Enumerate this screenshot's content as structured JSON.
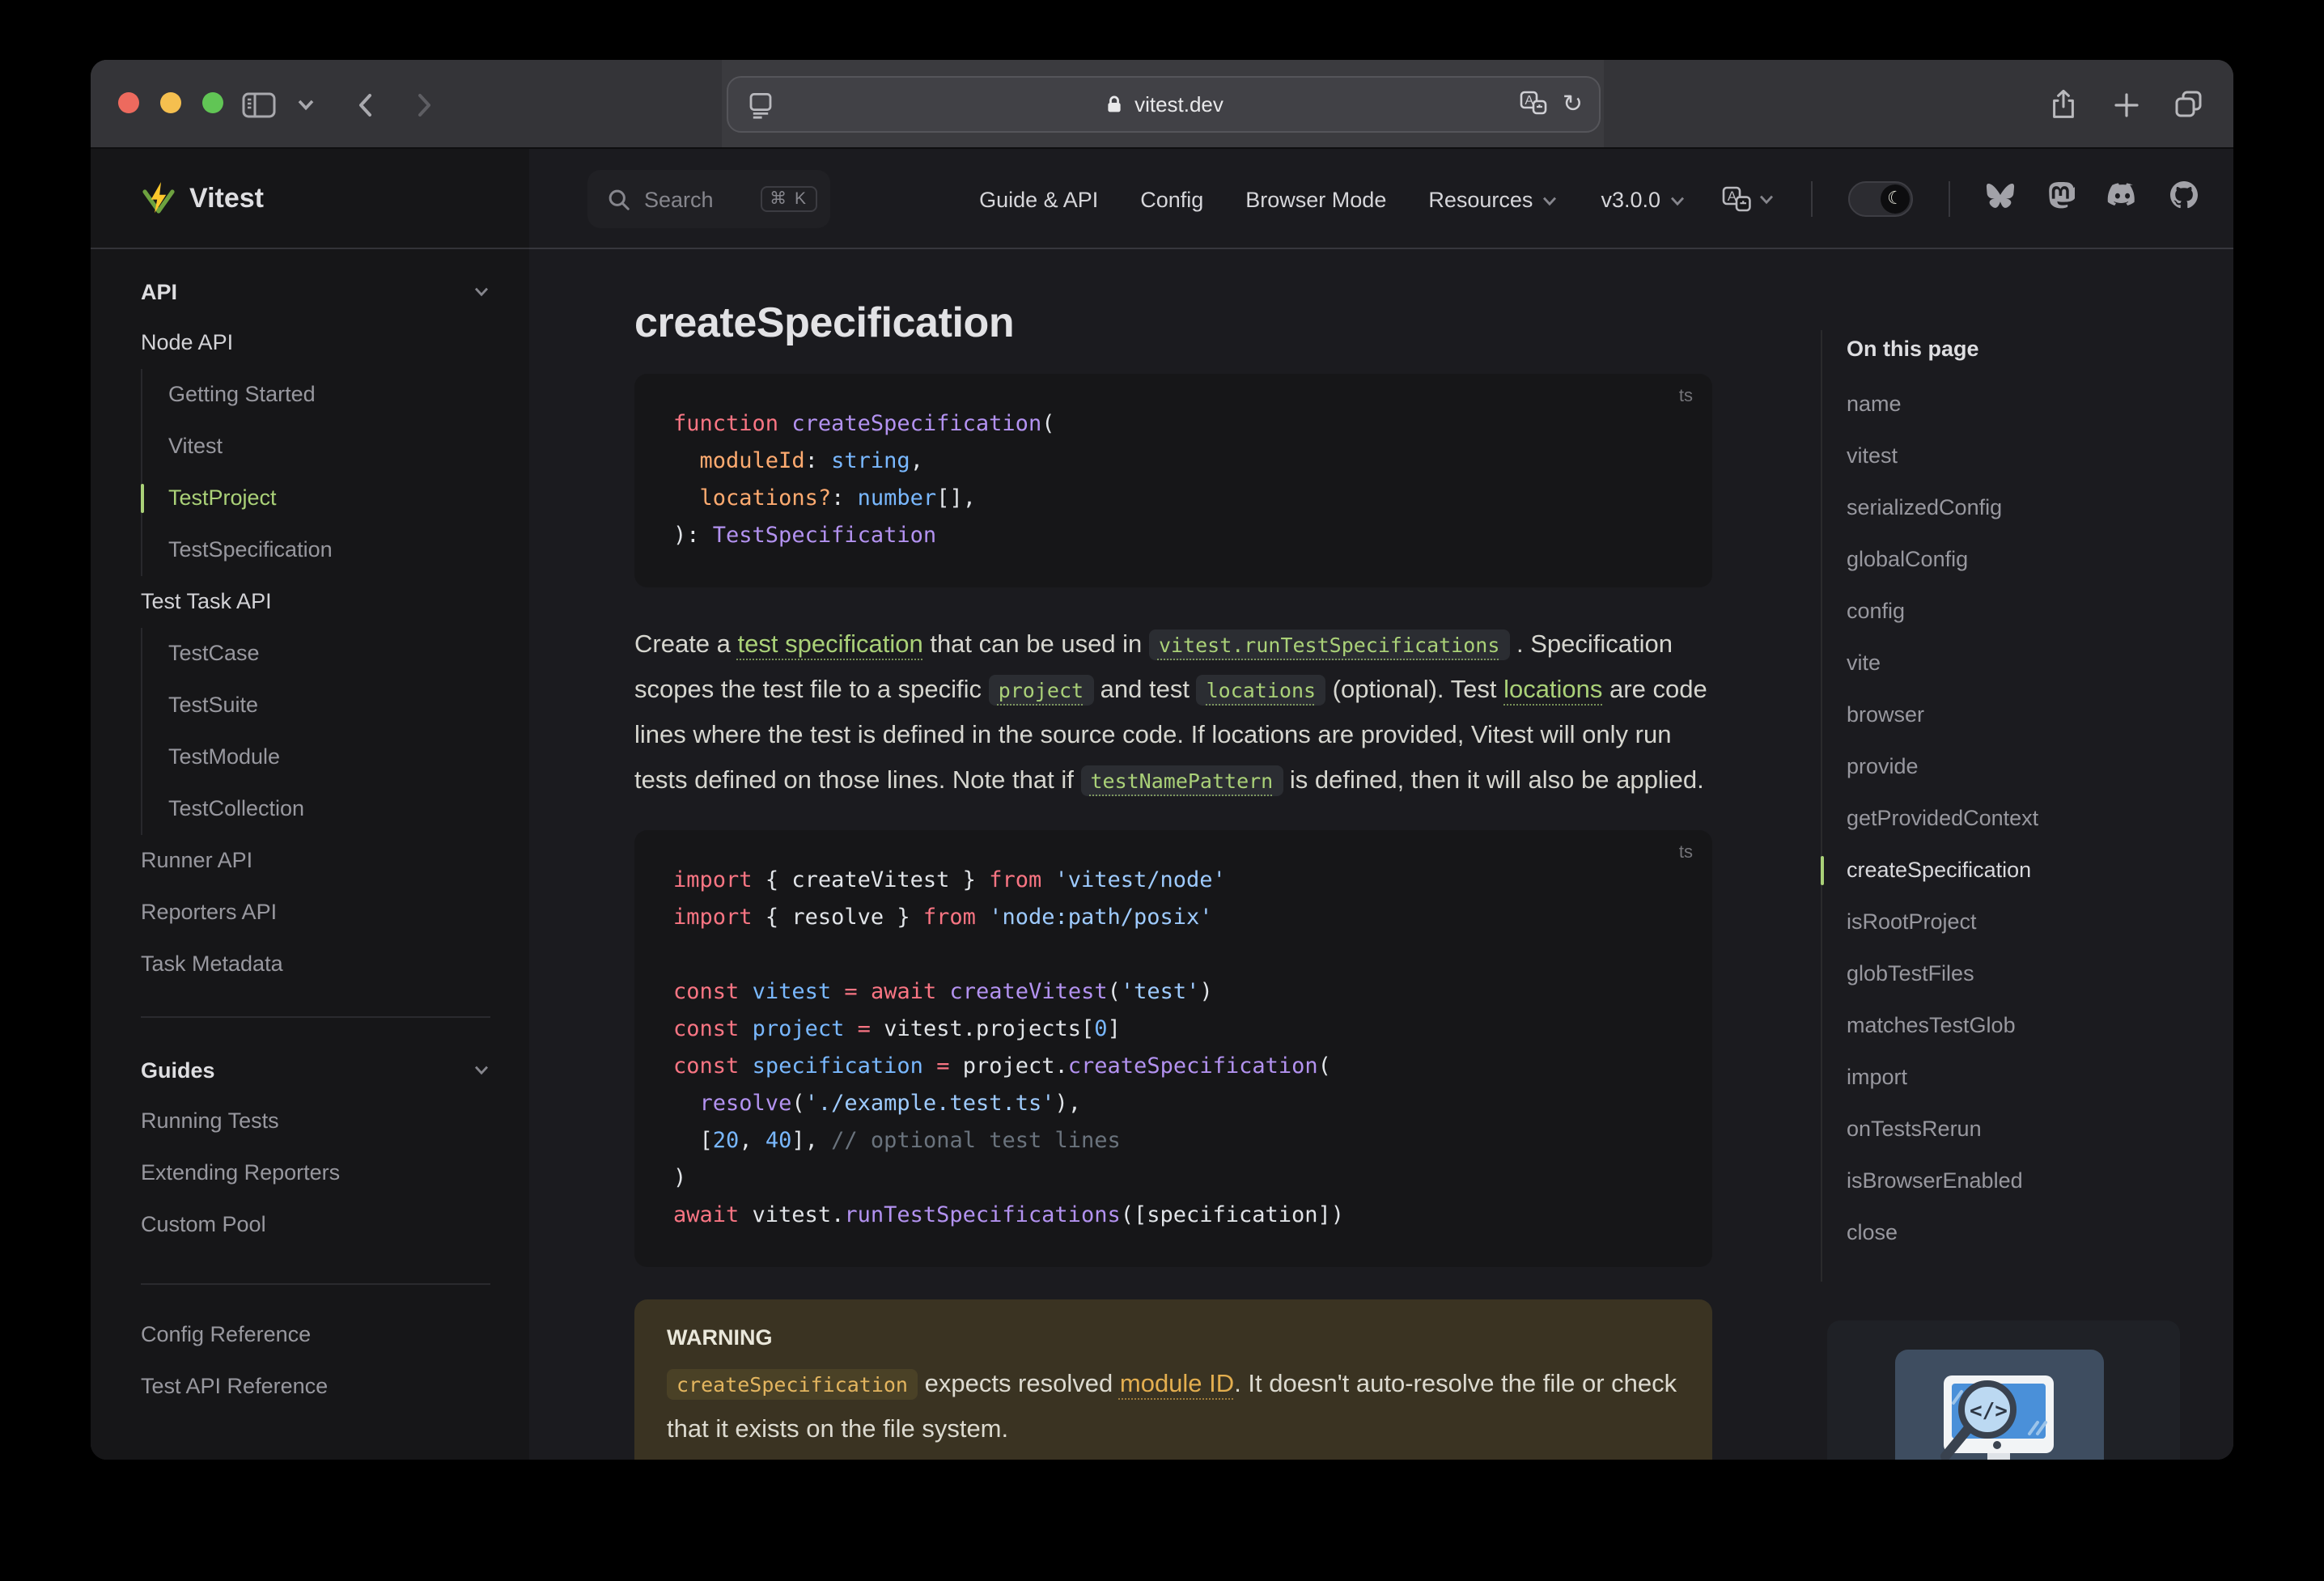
{
  "browser": {
    "url": "vitest.dev",
    "traffic_lights": [
      "close",
      "minimize",
      "zoom"
    ]
  },
  "nav": {
    "search_label": "Search",
    "search_kbd": "⌘ K",
    "items": [
      {
        "label": "Guide & API",
        "chevron": false
      },
      {
        "label": "Config",
        "chevron": false
      },
      {
        "label": "Browser Mode",
        "chevron": false
      },
      {
        "label": "Resources",
        "chevron": true
      },
      {
        "label": "v3.0.0",
        "chevron": true
      }
    ],
    "socials": [
      "bluesky",
      "mastodon",
      "discord",
      "github"
    ]
  },
  "sidebar": {
    "logo_text": "Vitest",
    "entries": [
      {
        "kind": "section",
        "label": "API"
      },
      {
        "kind": "group",
        "label": "Node API",
        "children": [
          {
            "label": "Getting Started",
            "active": false
          },
          {
            "label": "Vitest",
            "active": false
          },
          {
            "label": "TestProject",
            "active": true
          },
          {
            "label": "TestSpecification",
            "active": false
          }
        ]
      },
      {
        "kind": "group",
        "label": "Test Task API",
        "children": [
          {
            "label": "TestCase",
            "active": false
          },
          {
            "label": "TestSuite",
            "active": false
          },
          {
            "label": "TestModule",
            "active": false
          },
          {
            "label": "TestCollection",
            "active": false
          }
        ]
      },
      {
        "kind": "link",
        "label": "Runner API"
      },
      {
        "kind": "link",
        "label": "Reporters API"
      },
      {
        "kind": "link",
        "label": "Task Metadata"
      },
      {
        "kind": "divider"
      },
      {
        "kind": "section",
        "label": "Guides"
      },
      {
        "kind": "link",
        "label": "Running Tests"
      },
      {
        "kind": "link",
        "label": "Extending Reporters"
      },
      {
        "kind": "link",
        "label": "Custom Pool"
      },
      {
        "kind": "divider-lower"
      },
      {
        "kind": "link",
        "label": "Config Reference"
      },
      {
        "kind": "link",
        "label": "Test API Reference"
      }
    ]
  },
  "content": {
    "heading": "createSpecification",
    "code_blocks": [
      {
        "lang": "ts",
        "lines": [
          [
            [
              "k",
              "function"
            ],
            [
              "pl",
              " "
            ],
            [
              "fn",
              "createSpecification"
            ],
            [
              "pl",
              "("
            ]
          ],
          [
            [
              "pl",
              "  "
            ],
            [
              "prm",
              "moduleId"
            ],
            [
              "pl",
              ": "
            ],
            [
              "typ",
              "string"
            ],
            [
              "pl",
              ","
            ]
          ],
          [
            [
              "pl",
              "  "
            ],
            [
              "prm",
              "locations?"
            ],
            [
              "pl",
              ": "
            ],
            [
              "typ",
              "number"
            ],
            [
              "pl",
              "[],"
            ]
          ],
          [
            [
              "pl",
              "): "
            ],
            [
              "fn",
              "TestSpecification"
            ]
          ]
        ]
      },
      {
        "lang": "ts",
        "lines": [
          [
            [
              "k",
              "import"
            ],
            [
              "pl",
              " { createVitest } "
            ],
            [
              "k",
              "from"
            ],
            [
              "pl",
              " "
            ],
            [
              "str",
              "'vitest/node'"
            ]
          ],
          [
            [
              "k",
              "import"
            ],
            [
              "pl",
              " { resolve } "
            ],
            [
              "k",
              "from"
            ],
            [
              "pl",
              " "
            ],
            [
              "str",
              "'node:path/posix'"
            ]
          ],
          [],
          [
            [
              "k",
              "const"
            ],
            [
              "pl",
              " "
            ],
            [
              "var",
              "vitest"
            ],
            [
              "pl",
              " "
            ],
            [
              "k",
              "="
            ],
            [
              "pl",
              " "
            ],
            [
              "k",
              "await"
            ],
            [
              "pl",
              " "
            ],
            [
              "fn",
              "createVitest"
            ],
            [
              "pl",
              "("
            ],
            [
              "str",
              "'test'"
            ],
            [
              "pl",
              ")"
            ]
          ],
          [
            [
              "k",
              "const"
            ],
            [
              "pl",
              " "
            ],
            [
              "var",
              "project"
            ],
            [
              "pl",
              " "
            ],
            [
              "k",
              "="
            ],
            [
              "pl",
              " vitest.projects["
            ],
            [
              "num",
              "0"
            ],
            [
              "pl",
              "]"
            ]
          ],
          [
            [
              "k",
              "const"
            ],
            [
              "pl",
              " "
            ],
            [
              "var",
              "specification"
            ],
            [
              "pl",
              " "
            ],
            [
              "k",
              "="
            ],
            [
              "pl",
              " project."
            ],
            [
              "fn",
              "createSpecification"
            ],
            [
              "pl",
              "("
            ]
          ],
          [
            [
              "pl",
              "  "
            ],
            [
              "fn",
              "resolve"
            ],
            [
              "pl",
              "("
            ],
            [
              "str",
              "'./example.test.ts'"
            ],
            [
              "pl",
              "),"
            ]
          ],
          [
            [
              "pl",
              "  ["
            ],
            [
              "num",
              "20"
            ],
            [
              "pl",
              ", "
            ],
            [
              "num",
              "40"
            ],
            [
              "pl",
              "], "
            ],
            [
              "cmt",
              "// optional test lines"
            ]
          ],
          [
            [
              "pl",
              ")"
            ]
          ],
          [
            [
              "k",
              "await"
            ],
            [
              "pl",
              " vitest."
            ],
            [
              "fn",
              "runTestSpecifications"
            ],
            [
              "pl",
              "([specification])"
            ]
          ]
        ]
      }
    ],
    "paragraph_runs": [
      {
        "t": "Create a ",
        "s": "plain"
      },
      {
        "t": "test specification",
        "s": "link"
      },
      {
        "t": " that can be used in ",
        "s": "plain"
      },
      {
        "t": "vitest.runTestSpecifications",
        "s": "codelink"
      },
      {
        "t": " . Specification scopes the test file to a specific ",
        "s": "plain"
      },
      {
        "t": "project",
        "s": "code"
      },
      {
        "t": " and test ",
        "s": "plain"
      },
      {
        "t": "locations",
        "s": "code"
      },
      {
        "t": " (optional). Test ",
        "s": "plain"
      },
      {
        "t": "locations",
        "s": "link"
      },
      {
        "t": " are code lines where the test is defined in the source code. If locations are provided, Vitest will only run tests defined on those lines. Note that if ",
        "s": "plain"
      },
      {
        "t": "testNamePattern",
        "s": "codelink"
      },
      {
        "t": " is defined, then it will also be applied.",
        "s": "plain"
      }
    ],
    "warning": {
      "title": "WARNING",
      "runs": [
        {
          "t": "createSpecification",
          "s": "wcode"
        },
        {
          "t": " expects resolved ",
          "s": "plain"
        },
        {
          "t": "module ID",
          "s": "wlink"
        },
        {
          "t": ". It doesn't auto-resolve the file or check that it exists on the file system.",
          "s": "plain"
        }
      ]
    }
  },
  "toc": {
    "title": "On this page",
    "items": [
      {
        "label": "name",
        "active": false
      },
      {
        "label": "vitest",
        "active": false
      },
      {
        "label": "serializedConfig",
        "active": false
      },
      {
        "label": "globalConfig",
        "active": false
      },
      {
        "label": "config",
        "active": false
      },
      {
        "label": "vite",
        "active": false
      },
      {
        "label": "browser",
        "active": false
      },
      {
        "label": "provide",
        "active": false
      },
      {
        "label": "getProvidedContext",
        "active": false
      },
      {
        "label": "createSpecification",
        "active": true
      },
      {
        "label": "isRootProject",
        "active": false
      },
      {
        "label": "globTestFiles",
        "active": false
      },
      {
        "label": "matchesTestGlob",
        "active": false
      },
      {
        "label": "import",
        "active": false
      },
      {
        "label": "onTestsRerun",
        "active": false
      },
      {
        "label": "isBrowserEnabled",
        "active": false
      },
      {
        "label": "close",
        "active": false
      }
    ]
  },
  "colors": {
    "brand_green": "#aad178",
    "page_bg": "#1b1b1f",
    "sidebar_bg": "#161618",
    "code_block_bg": "#161618",
    "code_keyword": "#f97583",
    "code_function": "#b392f0",
    "code_param": "#ffab70",
    "code_type_number": "#79b8ff",
    "code_string": "#9ecbff",
    "code_comment": "#6a737d",
    "warning_bg": "#3a3322",
    "warning_accent": "#e3ae4f",
    "traffic_red": "#ed6a5e",
    "traffic_yellow": "#f5bf4f",
    "traffic_green": "#61c555"
  }
}
